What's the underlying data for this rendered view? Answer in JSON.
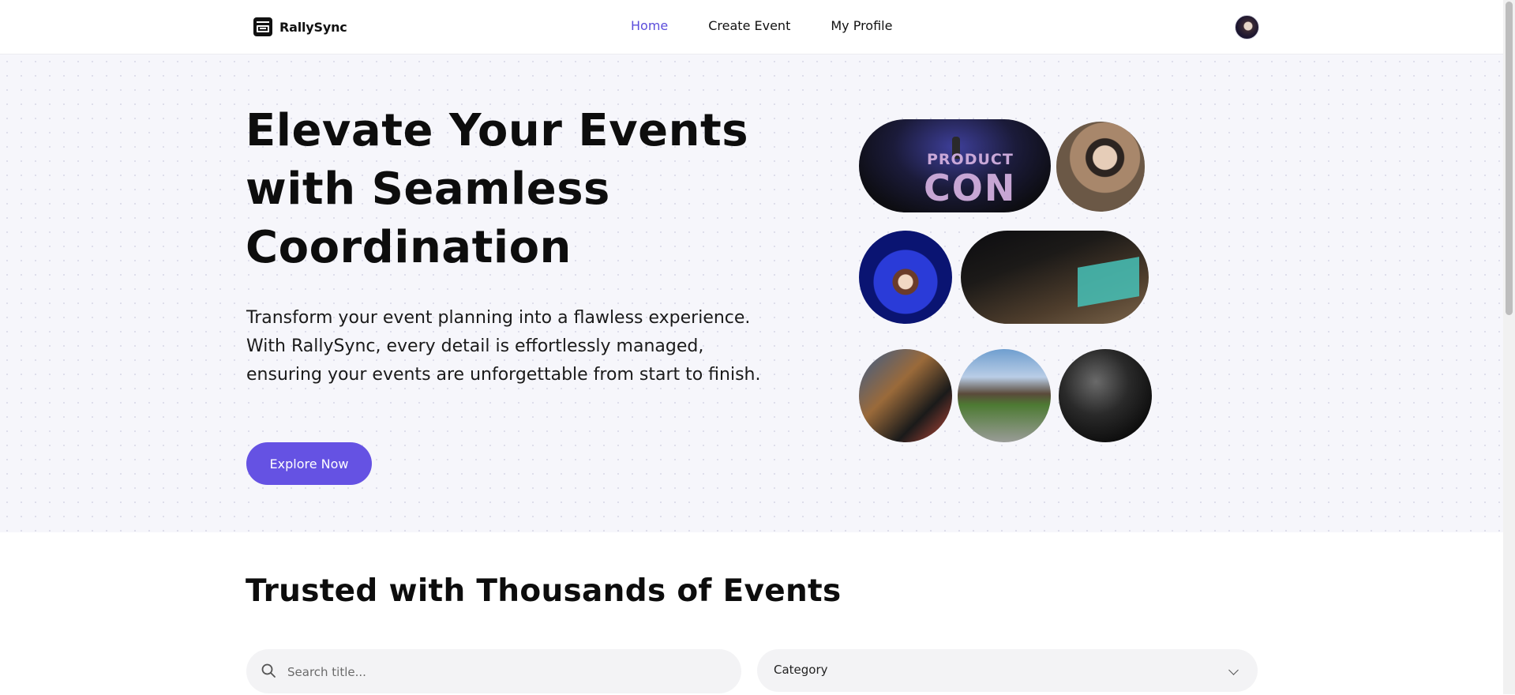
{
  "nav": {
    "brand": "RallySync",
    "links": [
      {
        "label": "Home",
        "active": true
      },
      {
        "label": "Create Event",
        "active": false
      },
      {
        "label": "My Profile",
        "active": false
      }
    ],
    "avatar_icon": "user-avatar",
    "active_color": "#5b4ddb"
  },
  "hero": {
    "title": "Elevate Your Events with Seamless Coordination",
    "subtitle": "Transform your event planning into a flawless experience. With RallySync, every detail is effortlessly managed, ensuring your events are unforgettable from start to finish.",
    "cta_label": "Explore Now",
    "cta_color": "#6552e3",
    "photo_texts": {
      "ph1_line1": "PRODUCT",
      "ph1_line2": "CON"
    }
  },
  "events_section": {
    "title": "Trusted with Thousands of Events",
    "search": {
      "placeholder": "Search title...",
      "value": ""
    },
    "category": {
      "selected": "Category"
    }
  }
}
